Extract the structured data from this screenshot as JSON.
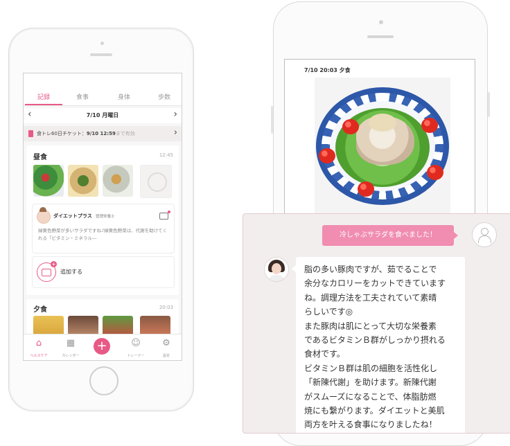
{
  "left_phone": {
    "tabs": [
      "記録",
      "食事",
      "身体",
      "歩数"
    ],
    "date_label": "7/10 月曜日",
    "nav_prev": "‹",
    "nav_next": "›",
    "ticket": {
      "prefix": "食トレ60日チケット：",
      "deadline": "9/10 12:59",
      "suffix": "まで有効"
    },
    "lunch": {
      "title": "昼食",
      "time": "12:45",
      "advisor_name": "ダイエットプラス",
      "advisor_role": "管理栄養士",
      "message": "緑黄色野菜が多いサラダですね♪緑黄色野菜は、代謝を助けてくれる「ビタミン・ミネラル―",
      "add_label": "追加する"
    },
    "dinner": {
      "title": "夕食",
      "time": "20:03"
    },
    "bottom_nav": [
      {
        "label": "ヘルスケア",
        "icon": "home-icon",
        "glyph": "⌂"
      },
      {
        "label": "カレンダー",
        "icon": "calendar-icon",
        "glyph": "▦"
      },
      {
        "label": "",
        "icon": "plus-icon",
        "glyph": "+"
      },
      {
        "label": "トレーナー",
        "icon": "chat-icon",
        "glyph": "☺"
      },
      {
        "label": "設定",
        "icon": "gear-icon",
        "glyph": "⚙"
      }
    ],
    "accent_color": "#e85a86"
  },
  "right_phone": {
    "post_time": "7/10 20:03 夕食",
    "user_message": "冷しゃぶサラダを食べました！",
    "advisor_reply": "脂の多い豚肉ですが、茹でることで\n余分なカロリーをカットできています\nね。調理方法を工夫されていて素晴\nらしいです◎\nまた豚肉は肌にとって大切な栄養素\nであるビタミンＢ群がしっかり摂れる\n食材です。\nビタミンＢ群は肌の細胞を活性化し\n「新陳代謝」を助けます。新陳代謝\nがスムーズになることで、体脂肪燃\n焼にも繋がります。ダイエットと美肌\n両方を叶える食事になりましたね！",
    "bubble_color": "#f08db0"
  }
}
